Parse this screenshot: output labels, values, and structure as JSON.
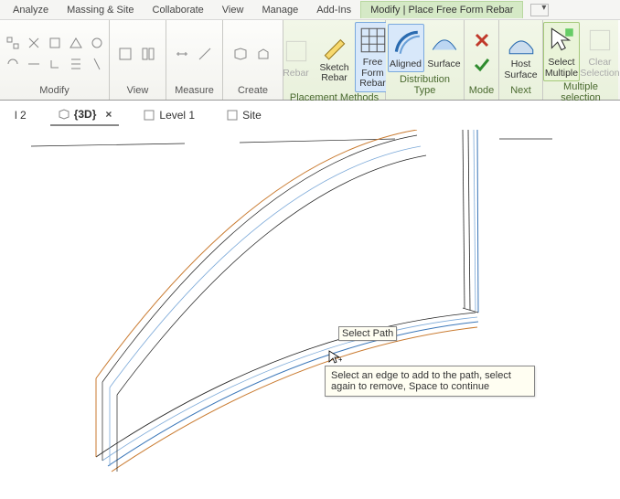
{
  "menus": {
    "analyze": "Analyze",
    "massing": "Massing & Site",
    "collaborate": "Collaborate",
    "view": "View",
    "manage": "Manage",
    "addins": "Add-Ins",
    "context": "Modify | Place Free Form Rebar"
  },
  "panels": {
    "modify": "Modify",
    "view": "View",
    "measure": "Measure",
    "create": "Create",
    "placement": "Placement Methods",
    "distribution": "Distribution Type",
    "mode": "Mode",
    "next": "Next",
    "multiple": "Multiple selection"
  },
  "buttons": {
    "rebar": "Rebar",
    "sketch": "Sketch\nRebar",
    "freeform": "Free Form\nRebar",
    "aligned": "Aligned",
    "surface": "Surface",
    "host": "Host\nSurface",
    "select_multiple": "Select\nMultiple",
    "clear": "Clear\nSelection"
  },
  "view_tabs": {
    "left_partial": "l 2",
    "three_d": "{3D}",
    "level1": "Level 1",
    "site": "Site"
  },
  "overlay": {
    "select_path": "Select Path",
    "tooltip": "Select an edge to add to the path, select again to remove, Space to continue"
  }
}
